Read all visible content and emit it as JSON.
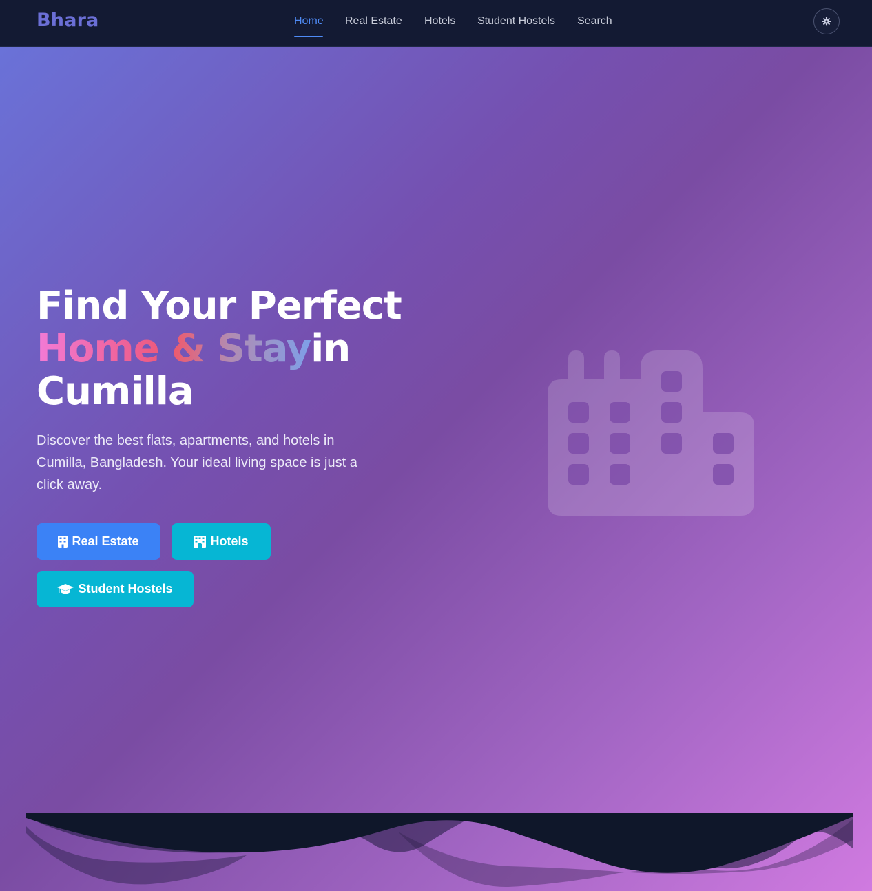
{
  "brand": {
    "name": "Bhara"
  },
  "nav": {
    "items": [
      {
        "label": "Home",
        "active": true
      },
      {
        "label": "Real Estate",
        "active": false
      },
      {
        "label": "Hotels",
        "active": false
      },
      {
        "label": "Student Hostels",
        "active": false
      },
      {
        "label": "Search",
        "active": false
      }
    ],
    "theme_toggle_icon": "gear-icon"
  },
  "hero": {
    "title_line1": "Find Your Perfect",
    "title_highlight": "Home & Stay",
    "title_suffix": "in",
    "title_line3": "Cumilla",
    "subtitle": "Discover the best flats, apartments, and hotels in Cumilla, Bangladesh. Your ideal living space is just a click away.",
    "buttons": [
      {
        "label": "Real Estate",
        "icon": "building-icon"
      },
      {
        "label": "Hotels",
        "icon": "hotel-icon"
      },
      {
        "label": "Student Hostels",
        "icon": "graduation-cap-icon"
      }
    ],
    "illustration_icon": "city-buildings-icon"
  },
  "colors": {
    "navbar_bg": "#131a33",
    "brand": "#6b6fd6",
    "nav_active": "#4f8bf6",
    "btn_primary": "#3b82f6",
    "btn_cyan": "#06b6d4",
    "footer_dark": "#0f172a"
  }
}
